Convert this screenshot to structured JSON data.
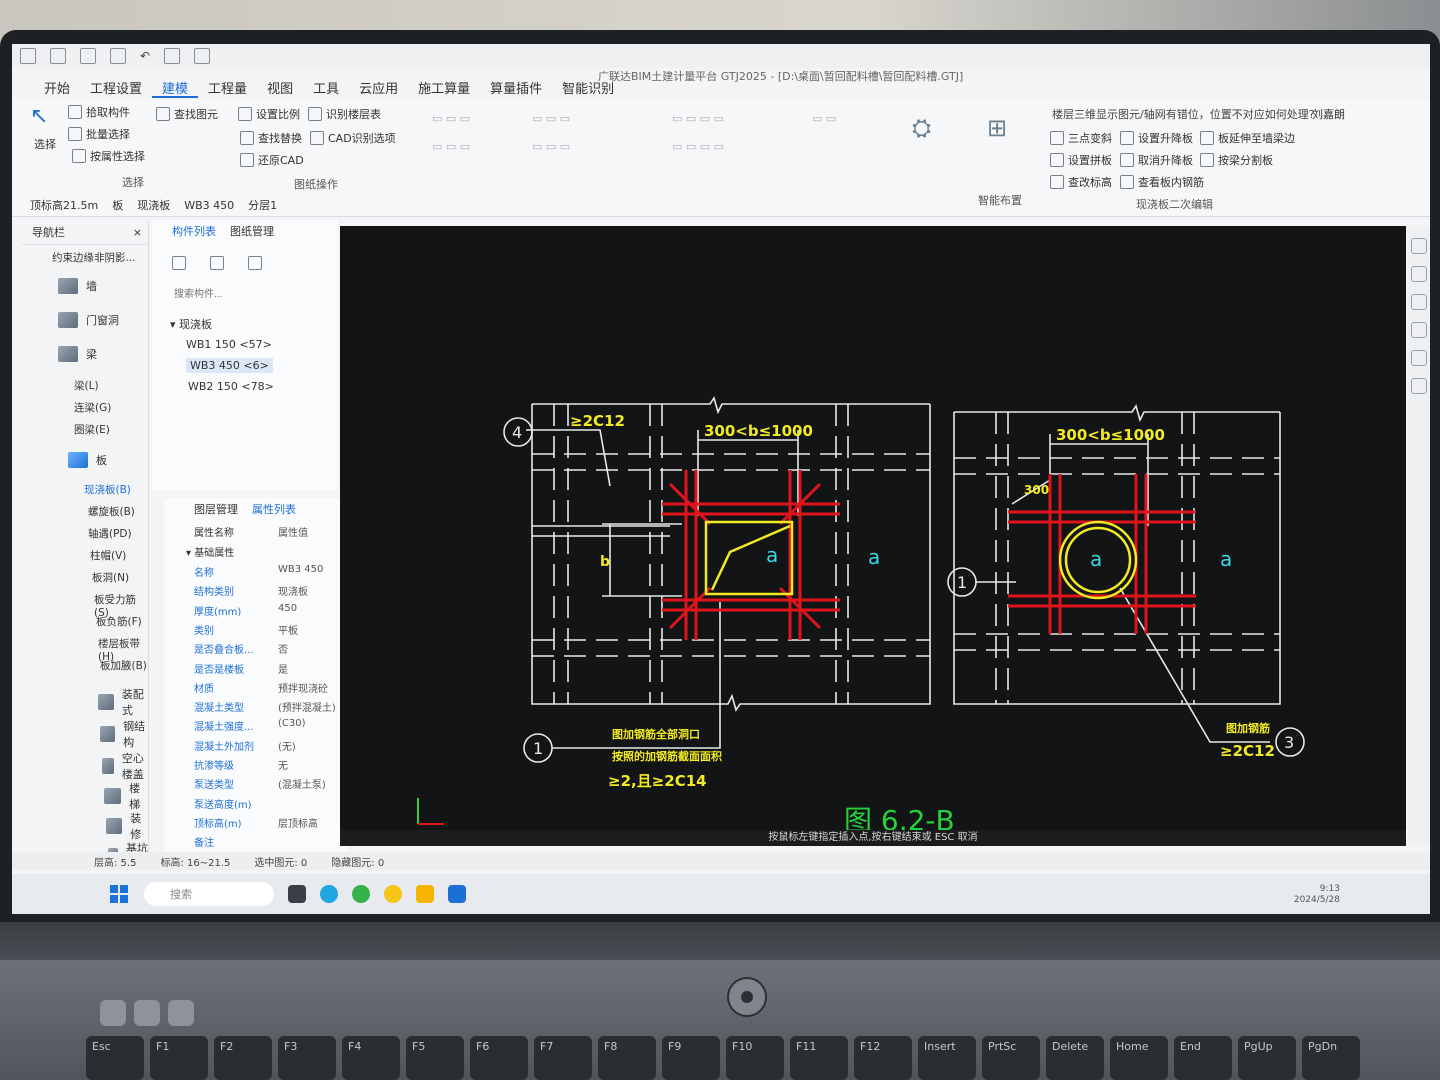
{
  "window": {
    "title": "广联达BIM土建计量平台 GTJ2025 - [D:\\桌面\\暂回配料槽\\暂回配料槽.GTJ]"
  },
  "menu": [
    "开始",
    "工程设置",
    "建模",
    "工程量",
    "视图",
    "工具",
    "云应用",
    "施工算量",
    "算量插件",
    "智能识别"
  ],
  "ribbon": {
    "select_label": "选择",
    "pick": "拾取构件",
    "batch": "批量选择",
    "attr_select": "按属性选择",
    "group_select": "选择",
    "find": "查找图元",
    "set_ratio": "设置比例",
    "recognize_floor": "识别楼层表",
    "find_replace": "查找替换",
    "cad_options": "CAD识别选项",
    "restore_cad": "还原CAD",
    "group_drawing": "图纸操作",
    "smart_layout": "智能布置",
    "help_question": "楼层三维显示图元/轴网有错位，位置不对应如何处理?",
    "user": "刘嘉朗",
    "three_point": "三点变斜",
    "set_lift": "设置升降板",
    "extend_beam": "板延伸至墙梁边",
    "set_slab": "设置拼板",
    "cancel_lift": "取消升降板",
    "split_by_beam": "按梁分割板",
    "check_elev": "查改标高",
    "view_rebar": "查看板内钢筋",
    "group_edit": "现浇板二次编辑"
  },
  "selbar": {
    "floor": "顶标高21.5m",
    "type": "板",
    "subtype": "现浇板",
    "component": "WB3 450",
    "layer": "分层1"
  },
  "nav": {
    "title": "导航栏",
    "current": "约束边缘非阴影...",
    "cats": [
      "墙",
      "门窗洞",
      "梁"
    ],
    "beam_subs": [
      "梁(L)",
      "连梁(G)",
      "圈梁(E)"
    ],
    "slab": "板",
    "slab_subs": [
      "现浇板(B)",
      "螺旋板(B)",
      "轴遇(PD)",
      "柱帽(V)",
      "板洞(N)",
      "板受力筋(S)",
      "板负筋(F)",
      "楼层板带(H)",
      "板加腋(B)"
    ],
    "more": [
      "装配式",
      "钢结构",
      "空心楼盖",
      "楼梯",
      "装修",
      "基坑支护"
    ]
  },
  "complist": {
    "tab1": "构件列表",
    "tab2": "图纸管理",
    "search": "搜索构件...",
    "group": "现浇板",
    "items": [
      "WB1 150 <57>",
      "WB3 450 <6>",
      "WB2 150 <78>"
    ]
  },
  "props": {
    "tab1": "图层管理",
    "tab2": "属性列表",
    "col1": "属性名称",
    "col2": "属性值",
    "section": "基础属性",
    "rows": [
      {
        "k": "名称",
        "v": "WB3 450"
      },
      {
        "k": "结构类别",
        "v": "现浇板"
      },
      {
        "k": "厚度(mm)",
        "v": "450"
      },
      {
        "k": "类别",
        "v": "平板"
      },
      {
        "k": "是否叠合板...",
        "v": "否"
      },
      {
        "k": "是否是楼板",
        "v": "是"
      },
      {
        "k": "材质",
        "v": "预拌现浇砼"
      },
      {
        "k": "混凝土类型",
        "v": "(预拌混凝土)"
      },
      {
        "k": "混凝土强度...",
        "v": "(C30)"
      },
      {
        "k": "混凝土外加剂",
        "v": "(无)"
      },
      {
        "k": "抗渗等级",
        "v": "无"
      },
      {
        "k": "泵送类型",
        "v": "(混凝土泵)"
      },
      {
        "k": "泵送高度(m)",
        "v": ""
      },
      {
        "k": "顶标高(m)",
        "v": "层顶标高"
      },
      {
        "k": "备注",
        "v": ""
      }
    ]
  },
  "cad": {
    "left_dim": "300<b≤1000",
    "right_dim": "300<b≤1000",
    "bubble4": "4",
    "bubble1a": "1",
    "bubble1b": "1",
    "bubble3": "3",
    "rebar_top": "≥2C12",
    "rebar_right": "≥2C12",
    "b": "b",
    "d300": "300",
    "a": "a",
    "note1": "图加钢筋全部洞口",
    "note2": "按照的加钢筋截面面积",
    "note3": "≥2,且≥2C14",
    "note4": "图加钢筋",
    "title": "图 6.2-B"
  },
  "cmdline": "按鼠标左键指定插入点,按右键结束或 ESC 取消",
  "status": {
    "floor_h": "层高: 5.5",
    "elev": "标高: 16~21.5",
    "selected": "选中图元: 0",
    "hidden": "隐藏图元: 0"
  },
  "taskbar": {
    "search": "搜索",
    "time": "9:13",
    "date": "2024/5/28"
  },
  "keys": [
    "Esc",
    "F1",
    "F2",
    "F3",
    "F4",
    "F5",
    "F6",
    "F7",
    "F8",
    "F9",
    "F10",
    "F11",
    "F12",
    "Insert",
    "PrtSc",
    "Delete",
    "Home",
    "End",
    "PgUp",
    "PgDn"
  ],
  "colors": {
    "accent": "#1d6fd6",
    "cad_bg": "#121416",
    "rebar": "#e0141b",
    "cad_yellow": "#f2ea23",
    "cad_green": "#27d13c",
    "cad_cyan": "#3ad7e0"
  }
}
